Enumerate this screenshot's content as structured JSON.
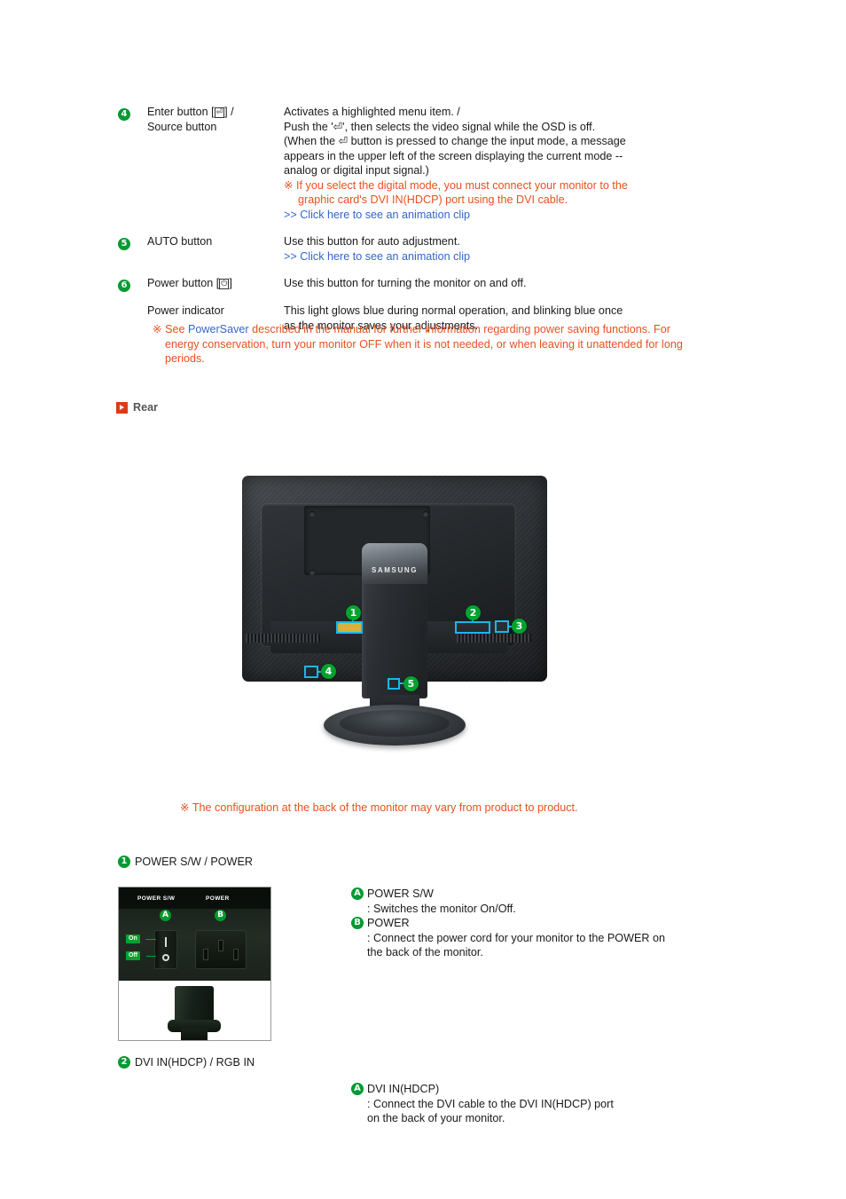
{
  "spec_rows": [
    {
      "num": "4",
      "label_line1": "Enter button [",
      "label_glyph": "⏎",
      "label_line1b": "] /",
      "label_line2": "Source button",
      "desc_lines": [
        "Activates a highlighted menu item. /",
        "Push the '⏎', then selects the video signal while the OSD is off.",
        "(When the ⏎ button is pressed to change the input mode, a message",
        "appears in the upper left of the screen displaying the current mode --",
        "analog or digital input signal.)"
      ],
      "note": "※ If you select the digital mode, you must connect your monitor to the",
      "note_cont": "graphic card's DVI IN(HDCP) port using the DVI cable.",
      "clip": ">> Click here to see an animation clip"
    },
    {
      "num": "5",
      "label_line1": "AUTO button",
      "label_line2": "",
      "desc_lines": [
        "Use this button for auto adjustment."
      ],
      "clip": ">> Click here to see an animation clip"
    },
    {
      "num": "6",
      "label_line1": "Power button [",
      "label_glyph": "⏻",
      "label_line1b": "]",
      "label_line2": "",
      "desc_lines": [
        "Use this button for turning the monitor on and off."
      ]
    },
    {
      "num": "",
      "label_line1": "Power indicator",
      "label_line2": "",
      "desc_lines": [
        "This light glows blue during normal operation, and blinking blue once",
        "as the monitor saves your adjustments."
      ]
    }
  ],
  "powersaver_note": {
    "mark": "※",
    "pre": "See ",
    "link": "PowerSaver",
    "post": " described in the manual for further information regarding power saving functions. For energy conservation, turn your monitor OFF when it is not needed, or when leaving it unattended for long periods."
  },
  "rear_heading": "Rear",
  "monitor_figure": {
    "brand": "SAMSUNG",
    "callouts": [
      "1",
      "2",
      "3",
      "4",
      "5"
    ]
  },
  "config_note": "※ The configuration at the back of the monitor may vary from product to product.",
  "section1": {
    "num": "1",
    "title": "POWER S/W / POWER",
    "photo": {
      "label_left": "POWER S/W",
      "label_right": "POWER",
      "badge_left": "A",
      "badge_right": "B",
      "tag_on": "On",
      "tag_off": "Off"
    },
    "items": [
      {
        "badge": "A",
        "head": "POWER S/W",
        "body_lines": [
          ": Switches the monitor On/Off."
        ]
      },
      {
        "badge": "B",
        "head": "POWER",
        "body_lines": [
          ": Connect the power cord for your monitor to the POWER on",
          "the back of the monitor."
        ]
      }
    ]
  },
  "section2": {
    "num": "2",
    "title": "DVI IN(HDCP) / RGB IN",
    "items": [
      {
        "badge": "A",
        "head": "DVI IN(HDCP)",
        "body_lines": [
          ": Connect the DVI cable to the DVI IN(HDCP) port",
          "on the back of your monitor."
        ]
      }
    ]
  },
  "colors": {
    "green_badge": "#009933",
    "orange_note": "#e8501e",
    "link_blue": "#3366cc",
    "rear_arrow": "#dd3b12",
    "callout_cyan": "#18b8e8"
  }
}
